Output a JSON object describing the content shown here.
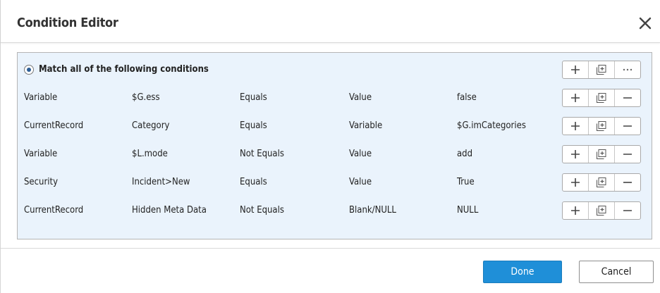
{
  "dialog": {
    "title": "Condition Editor",
    "close_icon": "close-icon"
  },
  "group": {
    "label": "Match all of the following conditions",
    "selected": true,
    "buttons": [
      "add-icon",
      "add-group-icon",
      "more-icon"
    ]
  },
  "conditions": [
    {
      "source": "Variable",
      "field": "$G.ess",
      "operator": "Equals",
      "value_type": "Value",
      "value": "false"
    },
    {
      "source": "CurrentRecord",
      "field": "Category",
      "operator": "Equals",
      "value_type": "Variable",
      "value": "$G.imCategories"
    },
    {
      "source": "Variable",
      "field": "$L.mode",
      "operator": "Not Equals",
      "value_type": "Value",
      "value": "add"
    },
    {
      "source": "Security",
      "field": "Incident>New",
      "operator": "Equals",
      "value_type": "Value",
      "value": "True"
    },
    {
      "source": "CurrentRecord",
      "field": "Hidden Meta Data",
      "operator": "Not Equals",
      "value_type": "Blank/NULL",
      "value": "NULL"
    }
  ],
  "footer": {
    "done_label": "Done",
    "cancel_label": "Cancel"
  },
  "colors": {
    "accent": "#1f8fd8",
    "panel_background": "#eaf3fc"
  }
}
